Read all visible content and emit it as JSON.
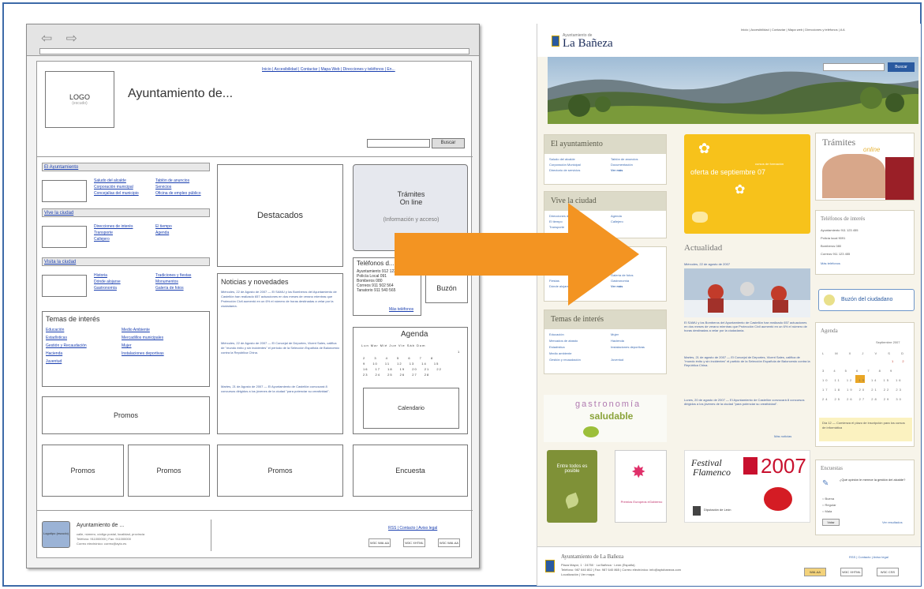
{
  "wireframe": {
    "nav_glyphs": "⇦ ⇨",
    "logo_text": "LOGO",
    "logo_sub": "(escudo)",
    "title": "Ayuntamiento de...",
    "top_links": "Inicio | Accesibilidad | Contactar | Mapa Web | Direcciones y teléfonos | En...",
    "search_button": "Buscar",
    "sec_ayuntamiento": "El Ayuntamiento",
    "links_ayto_1": [
      "Saludo del alcalde",
      "Corporación municipal",
      "Concejalías del municipio"
    ],
    "links_ayto_2": [
      "Tablón de anuncios",
      "Servicios",
      "Oficina de empleo público"
    ],
    "sec_vive": "Vive la ciudad",
    "links_vive_1": [
      "Direcciones de interés",
      "Transporte",
      "Callejero"
    ],
    "links_vive_2": [
      "El tiempo",
      "Agenda"
    ],
    "sec_visita": "Visita la ciudad",
    "links_visita_1": [
      "Historia",
      "Dónde alojarse",
      "Gastronomía"
    ],
    "links_visita_2": [
      "Tradiciones y fiestas",
      "Monumentos",
      "Galería de fotos"
    ],
    "temas_title": "Temas de interés",
    "temas_col1": [
      "Educación",
      "Estadísticas",
      "Gestión y Recaudación",
      "Hacienda",
      "Juventud"
    ],
    "temas_col2": [
      "Medio Ambiente",
      "Mercadillos municipales",
      "Mujer",
      "Instalaciones deportivas"
    ],
    "destacados": "Destacados",
    "tramites": "Trámites\nOn line",
    "tramites_sub": "(Información y acceso)",
    "telefonos": "Teléfonos d...",
    "buzon": "Buzón",
    "tel_rows": [
      "Ayuntamiento  912 123",
      "Policía Local  091",
      "Bomberos  080",
      "Correos  911 502 564",
      "Tanatorio  911 540 565"
    ],
    "tel_more": "Más teléfonos",
    "noticias": "Noticias y novedades",
    "news": [
      "Miércoles, 22 de Agosto de 2007 — El SAMU y los Bomberos del Ayuntamiento de Castellón han realizado 657 actuaciones en dos meses de verano mientras que Protección Civil aumentó en un 6% el número de horas destinadas a velar por la ciudadanía.",
      "Miércoles, 22 de Agosto de 2007 — El Concejal de Deportes, Vicent Sales, califica de \"mundo éxito y sin incidentes\" el periodo de la Selección Española de Baloncesto contra la República China.",
      "Martes, 21 de Agosto de 2007 — El Ayuntamiento de Castellón convocará 8 concursos dirigidos a los jóvenes de la ciudad \"para potenciar su creatividad\"."
    ],
    "agenda": "Agenda",
    "cal_head": "Lun Mar Mié Jue Vie Sáb Dom",
    "cal_rows": [
      "1",
      "2 3 4 5 6 7 8",
      "9 10 11 12 13 14 15",
      "16 17 18 19 20 21 22",
      "23 24 25 26 27 28"
    ],
    "calendario": "Calendario",
    "promos": "Promos",
    "encuesta": "Encuesta",
    "footer_logo": "Logotipo (escudo)",
    "footer_title": "Ayuntamiento de ...",
    "footer_lines": [
      "calle, número, código postal, localidad, provincia",
      "Teléfono: 911000000 | Fax: 911000000",
      "Correo electrónico: correo@ayto.es"
    ],
    "footer_links": "RSS | Contacto | Aviso legal",
    "badges": [
      "W3C WAI-AA",
      "W3C XHTML",
      "W3C WAI-AA"
    ]
  },
  "site": {
    "brand_small": "Ayuntamiento de",
    "brand": "La Bañeza",
    "top_links": "Inicio | Accesibilidad | Contactar | Mapa web | Direcciones y teléfonos | A A",
    "search_button": "Buscar",
    "panel_ayto": "El ayuntamiento",
    "ayto_links_1": [
      "Saludo del alcalde",
      "Corporación Municipal",
      "Directorio de servicios"
    ],
    "ayto_links_2": [
      "Tablón de anuncios",
      "Documentación",
      "Ver más"
    ],
    "panel_vive": "Vive la ciudad",
    "vive_links_1": [
      "Direcciones de interés",
      "El tiempo",
      "Transporte"
    ],
    "vive_links_2": [
      "Agenda",
      "Callejero"
    ],
    "visita_links_1": [
      "Fiestas",
      "Dónde alojarse"
    ],
    "visita_links_2": [
      "Galería de fotos",
      "Gastronomía",
      "Ver más"
    ],
    "panel_temas": "Temas de interés",
    "temas_1": [
      "Educación",
      "Mercados de abasto",
      "Estadística",
      "Medio ambiente",
      "Gestión y recaudación"
    ],
    "temas_2": [
      "Mujer",
      "Hacienda",
      "Instalaciones deportivas",
      "Juventud"
    ],
    "promo_small": "cursos de formación",
    "promo_big": "oferta de septiembre 07",
    "actualidad": "Actualidad",
    "act_date": "Miércoles, 22 de agosto de 2007",
    "act_news": [
      "El SAMU y los Bomberos del Ayuntamiento de Castellón han realizado 657 actuaciones en dos meses de verano mientras que Protección Civil aumentó en un 6% el número de horas destinadas a velar por la ciudadanía.",
      "Martes, 21 de agosto de 2007 — El Concejal de Deportes, Vicent Sales, califica de \"mundo éxito y sin incidentes\" el partido de la Selección Española de Baloncesto contra la República China.",
      "Lunes, 20 de agosto de 2007 — El Ayuntamiento de Castellón convocará 8 concursos dirigidos a los jóvenes de la ciudad \"para potenciar su creatividad\"."
    ],
    "act_more": "Más noticias",
    "gastro_1": "gastronomía",
    "gastro_2": "saludable",
    "entre_todos": "Entre todos es posible",
    "premios": "Premios Europeos eGobierno",
    "festival_1": "Festival",
    "festival_2": "Flamenco",
    "festival_year": "2007",
    "diputacion": "Diputación de León",
    "tramites": "Trámites",
    "tramites_online": "online",
    "tel_title": "Teléfonos de interés",
    "tel_rows": [
      "Ayuntamiento  911 123 455",
      "Policía local  9091",
      "Bomberos  080",
      "Correos  911 123 455"
    ],
    "tel_more": "Más teléfonos",
    "buzon": "Buzón del ciudadano",
    "agenda": "Agenda",
    "agenda_month": "Septiembre 2007",
    "cal_head": "L M X J V S D",
    "cal_rows": [
      "1 2",
      "3 4 5 6 7 8 9",
      "10 11 12 13 14 15 16",
      "17 18 19 20 21 22 23",
      "24 25 26 27 28 29 30"
    ],
    "agenda_note": "Día 12 — Comienza el plazo de inscripción para los cursos de informática",
    "encuestas": "Encuestas",
    "encuesta_q": "¿Qué opinión le merece la gestión del alcalde?",
    "encuesta_opts": [
      "Buena",
      "Regular",
      "Mala"
    ],
    "encuesta_btn": "Votar",
    "encuesta_results": "Ver resultados",
    "footer_title": "Ayuntamiento de La Bañeza",
    "footer_lines": [
      "Plaza Mayor, 1 · 24750 · La Bañeza · León (España)",
      "Teléfono: 987 640 802 | Fax: 987 640 865 | Correo electrónico: info@aytobaneza.com",
      "Localización | Ver mapa"
    ],
    "footer_links": "RSS | Contacto | Aviso legal",
    "badges": [
      "WAI-AA",
      "W3C XHTML",
      "W3C CSS"
    ]
  },
  "colors": {
    "frame": "#3d6aa8",
    "arrow": "#f39422",
    "site_blue": "#2a5aa0",
    "promo_yellow": "#f7c21b",
    "olive": "#8a9a3a"
  }
}
